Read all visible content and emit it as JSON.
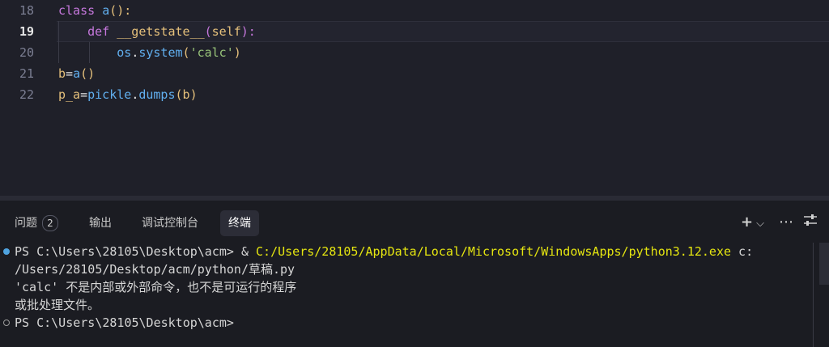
{
  "editor": {
    "lines": [
      {
        "number": "18",
        "tokens": [
          {
            "t": "class",
            "c": "kw"
          },
          {
            "t": " ",
            "c": "plain"
          },
          {
            "t": "a",
            "c": "meth"
          },
          {
            "t": "():",
            "c": "paren"
          }
        ]
      },
      {
        "number": "19",
        "tokens": [
          {
            "t": "    ",
            "c": "plain"
          },
          {
            "t": "def",
            "c": "kw"
          },
          {
            "t": " ",
            "c": "plain"
          },
          {
            "t": "__getstate__",
            "c": "fn"
          },
          {
            "t": "(",
            "c": "paren2"
          },
          {
            "t": "self",
            "c": "self"
          },
          {
            "t": "):",
            "c": "paren2"
          }
        ]
      },
      {
        "number": "20",
        "tokens": [
          {
            "t": "        ",
            "c": "plain"
          },
          {
            "t": "os",
            "c": "mod"
          },
          {
            "t": ".",
            "c": "plain"
          },
          {
            "t": "system",
            "c": "meth"
          },
          {
            "t": "(",
            "c": "paren"
          },
          {
            "t": "'calc'",
            "c": "str"
          },
          {
            "t": ")",
            "c": "paren"
          }
        ]
      },
      {
        "number": "21",
        "tokens": [
          {
            "t": "b",
            "c": "fn"
          },
          {
            "t": "=",
            "c": "plain"
          },
          {
            "t": "a",
            "c": "meth"
          },
          {
            "t": "()",
            "c": "paren"
          }
        ]
      },
      {
        "number": "22",
        "tokens": [
          {
            "t": "p_a",
            "c": "fn"
          },
          {
            "t": "=",
            "c": "plain"
          },
          {
            "t": "pickle",
            "c": "mod"
          },
          {
            "t": ".",
            "c": "plain"
          },
          {
            "t": "dumps",
            "c": "meth"
          },
          {
            "t": "(",
            "c": "paren"
          },
          {
            "t": "b",
            "c": "fn"
          },
          {
            "t": ")",
            "c": "paren"
          }
        ]
      }
    ],
    "active_line": "19"
  },
  "panel": {
    "tabs": [
      {
        "label": "问题",
        "badge": "2"
      },
      {
        "label": "输出"
      },
      {
        "label": "调试控制台"
      },
      {
        "label": "终端",
        "active": true
      }
    ],
    "actions": {
      "add_icon": "plus-icon",
      "dropdown_icon": "chevron-down-icon",
      "more_icon": "ellipsis-icon",
      "layout_icon": "sliders-icon"
    }
  },
  "terminal": {
    "line1_prompt": "PS C:\\Users\\28105\\Desktop\\acm> & ",
    "line1_exe": "C:/Users/28105/AppData/Local/Microsoft/WindowsApps/python3.12.exe",
    "line1_arg": " c:",
    "line2": "/Users/28105/Desktop/acm/python/草稿.py",
    "line3": "'calc' 不是内部或外部命令，也不是可运行的程序",
    "line4": "或批处理文件。",
    "line5": "PS C:\\Users\\28105\\Desktop\\acm>"
  },
  "colors": {
    "accent": "#4fa3e0",
    "exe_path": "#e5e510"
  }
}
